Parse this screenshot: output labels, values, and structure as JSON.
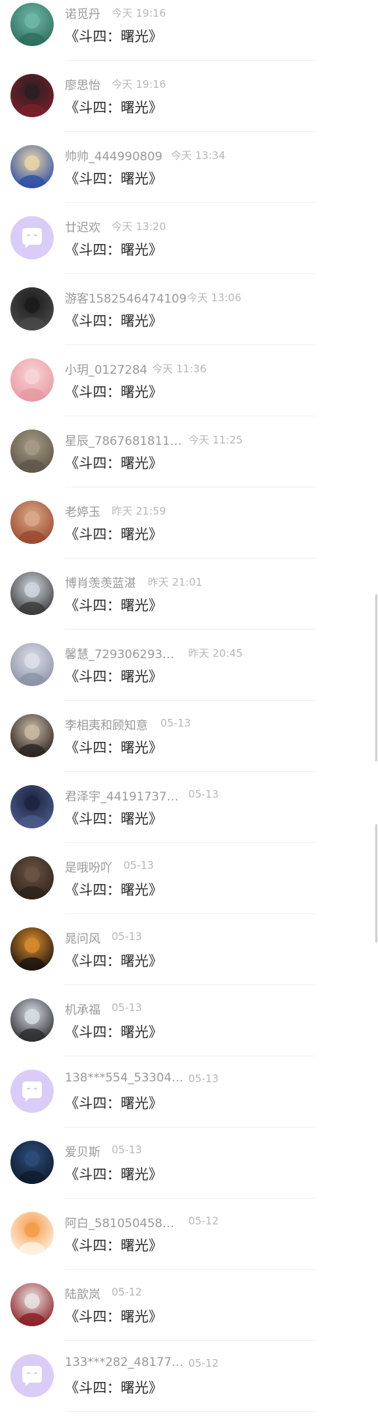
{
  "message_text": "《斗四：曙光》",
  "rows": [
    {
      "name": "诺觅丹",
      "time": "今天 19:16",
      "avatar": "photo-avatar-teal"
    },
    {
      "name": "廖思怡",
      "time": "今天 19:16",
      "avatar": "photo-avatar-dark"
    },
    {
      "name": "帅帅_444990809",
      "time": "今天 13:34",
      "avatar": "cartoon-avatar"
    },
    {
      "name": "廿迟欢",
      "time": "今天 13:20",
      "avatar": "default-chat-avatar"
    },
    {
      "name": "游客1582546474109",
      "time": "今天 13:06",
      "avatar": "photo-avatar-black"
    },
    {
      "name": "小玥_0127284",
      "time": "今天 11:36",
      "avatar": "cartoon-avatar-pink"
    },
    {
      "name": "星辰_7867681811…",
      "time": "今天 11:25",
      "avatar": "photo-avatar-girl"
    },
    {
      "name": "老婷玉",
      "time": "昨天 21:59",
      "avatar": "photo-avatar-hat"
    },
    {
      "name": "博肖羡羡蓝湛",
      "time": "昨天 21:01",
      "avatar": "cartoon-avatar-duo"
    },
    {
      "name": "馨慧_729306293…",
      "time": "昨天 20:45",
      "avatar": "photo-avatar-white"
    },
    {
      "name": "李相夷和顾知意",
      "time": "05-13",
      "avatar": "photo-avatar-man"
    },
    {
      "name": "君泽宇_44191737…",
      "time": "05-13",
      "avatar": "photo-avatar-navy"
    },
    {
      "name": "是哦吩吖",
      "time": "05-13",
      "avatar": "photo-avatar-brown"
    },
    {
      "name": "晁问风",
      "time": "05-13",
      "avatar": "photo-avatar-tiger"
    },
    {
      "name": "机承福",
      "time": "05-13",
      "avatar": "photo-avatar-lady"
    },
    {
      "name": "138***554_53304…",
      "time": "05-13",
      "avatar": "default-chat-avatar"
    },
    {
      "name": "爱贝斯",
      "time": "05-13",
      "avatar": "photo-avatar-blue"
    },
    {
      "name": "阿白_581050458…",
      "time": "05-12",
      "avatar": "cartoon-avatar-orange"
    },
    {
      "name": "陆歆岚",
      "time": "05-12",
      "avatar": "photo-avatar-red"
    },
    {
      "name": "133***282_48177…",
      "time": "05-12",
      "avatar": "default-chat-avatar"
    }
  ]
}
